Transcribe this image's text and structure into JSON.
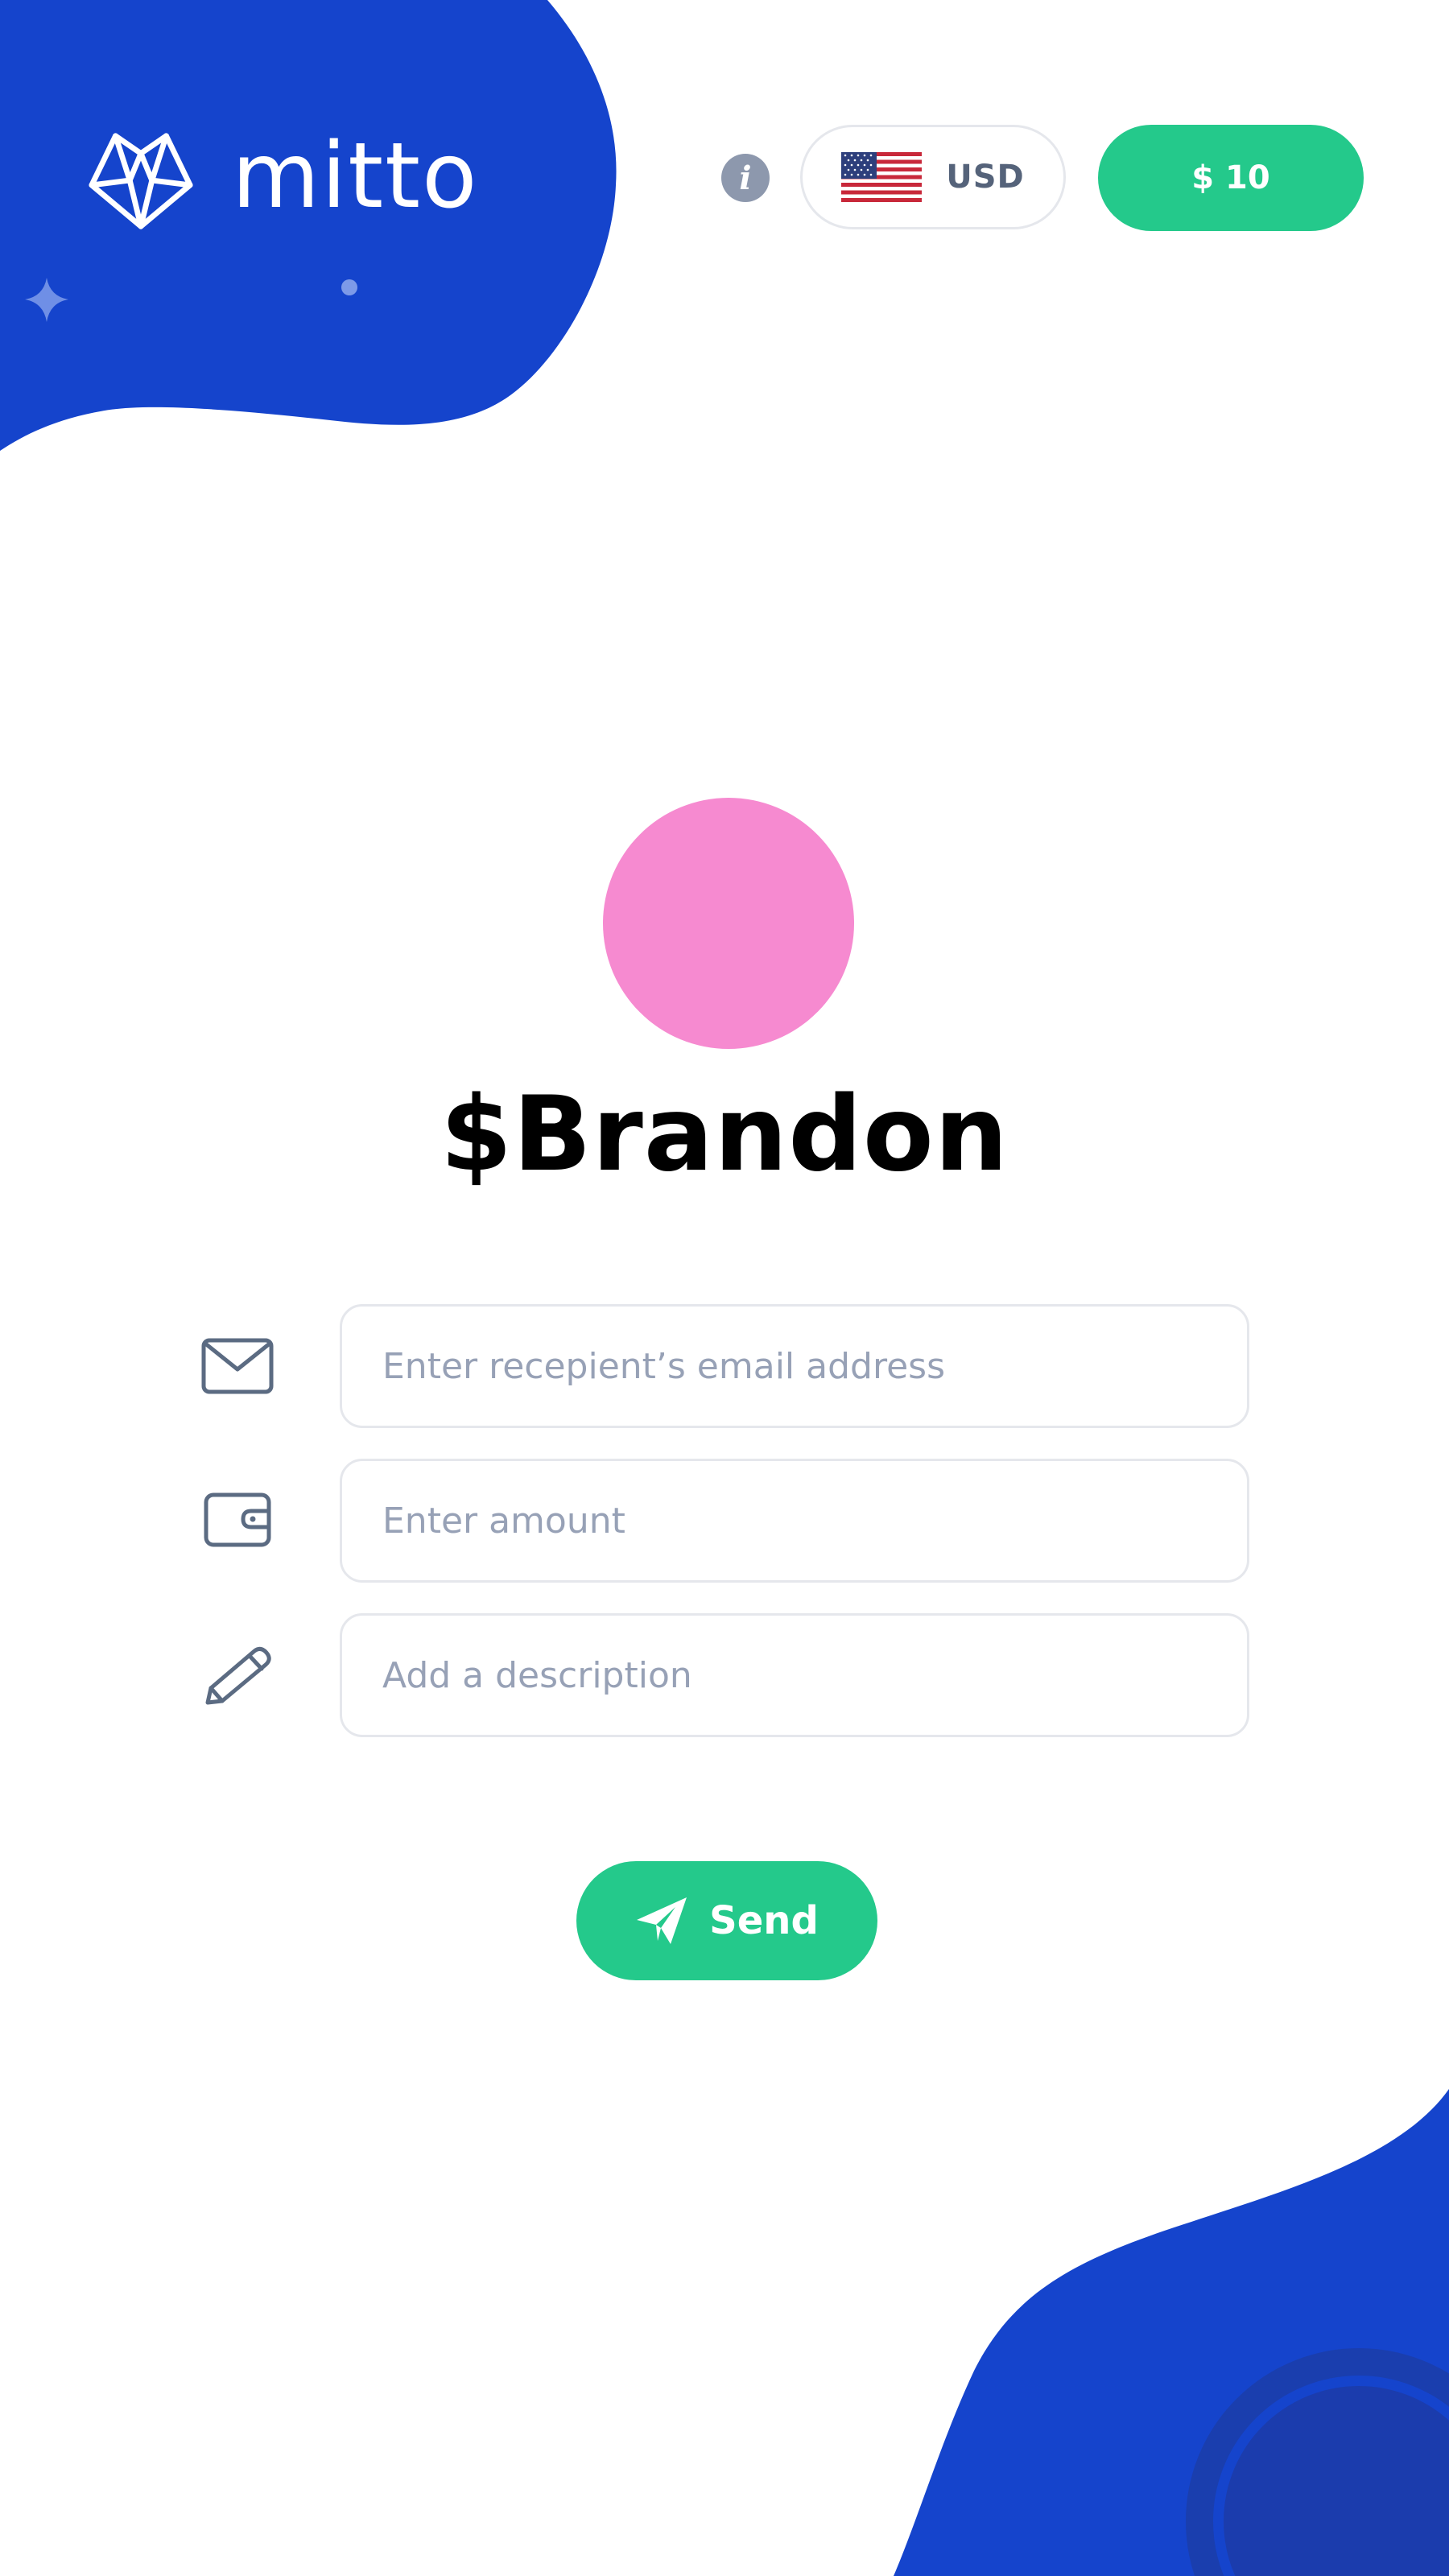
{
  "brand": {
    "name": "mitto",
    "color": "#1544cc"
  },
  "header": {
    "info_label": "i",
    "currency": {
      "code": "USD",
      "flag_icon": "us-flag-icon"
    },
    "balance_label": "$ 10"
  },
  "recipient": {
    "handle": "$Brandon",
    "avatar_color": "#f68ad0"
  },
  "form": {
    "email": {
      "placeholder": "Enter recepient’s email address",
      "value": "",
      "icon": "envelope-icon"
    },
    "amount": {
      "placeholder": "Enter amount",
      "value": "",
      "icon": "wallet-icon"
    },
    "description": {
      "placeholder": "Add a description",
      "value": "",
      "icon": "pencil-icon"
    }
  },
  "actions": {
    "send_label": "Send",
    "send_icon": "paper-plane-icon"
  },
  "colors": {
    "accent_green": "#24c98b",
    "brand_blue": "#1544cc",
    "icon_gray": "#5b6b82"
  }
}
